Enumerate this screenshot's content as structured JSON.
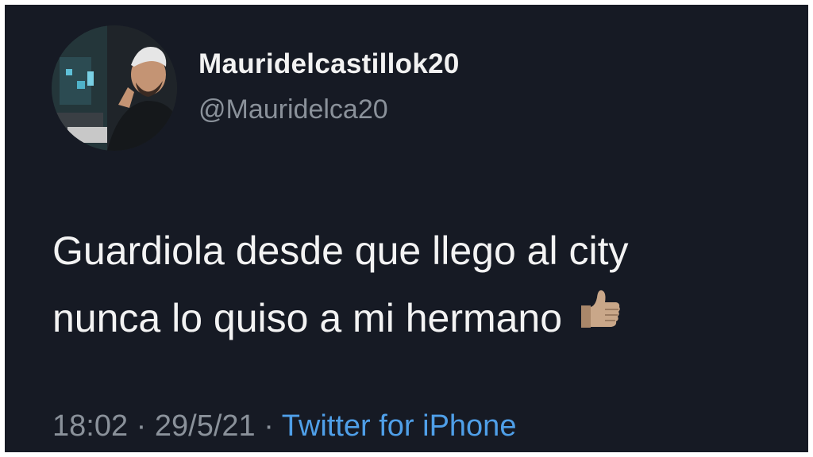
{
  "tweet": {
    "display_name": "Mauridelcastillok20",
    "handle": "@Mauridelca20",
    "text_lines": [
      "Guardiola desde que llego al city",
      "nunca lo quiso a mi hermano"
    ],
    "emoji": "thumbs-up-icon",
    "time": "18:02",
    "separator": "·",
    "date": "29/5/21",
    "source": "Twitter for iPhone"
  },
  "colors": {
    "background": "#161a24",
    "text": "#f3f3f3",
    "secondary": "#8a919a",
    "link": "#4f9fe8"
  }
}
